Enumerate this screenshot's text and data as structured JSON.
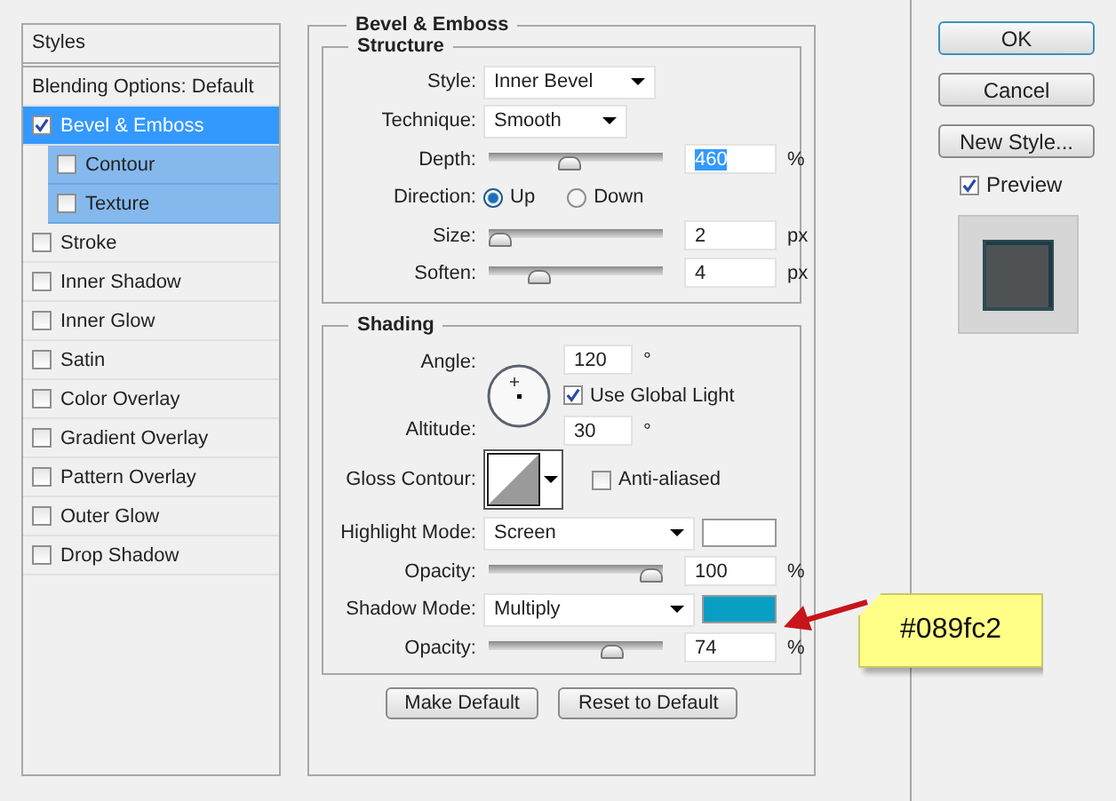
{
  "styles_panel": {
    "header": "Styles",
    "items": [
      {
        "label": "Blending Options: Default",
        "kind": "plain",
        "selected": false
      },
      {
        "label": "Bevel & Emboss",
        "kind": "checkbox",
        "checked": true,
        "selected": true,
        "children": [
          {
            "label": "Contour",
            "kind": "checkbox",
            "checked": false
          },
          {
            "label": "Texture",
            "kind": "checkbox",
            "checked": false
          }
        ]
      },
      {
        "label": "Stroke",
        "kind": "checkbox",
        "checked": false,
        "selected": false
      },
      {
        "label": "Inner Shadow",
        "kind": "checkbox",
        "checked": false,
        "selected": false
      },
      {
        "label": "Inner Glow",
        "kind": "checkbox",
        "checked": false,
        "selected": false
      },
      {
        "label": "Satin",
        "kind": "checkbox",
        "checked": false,
        "selected": false
      },
      {
        "label": "Color Overlay",
        "kind": "checkbox",
        "checked": false,
        "selected": false
      },
      {
        "label": "Gradient Overlay",
        "kind": "checkbox",
        "checked": false,
        "selected": false
      },
      {
        "label": "Pattern Overlay",
        "kind": "checkbox",
        "checked": false,
        "selected": false
      },
      {
        "label": "Outer Glow",
        "kind": "checkbox",
        "checked": false,
        "selected": false
      },
      {
        "label": "Drop Shadow",
        "kind": "checkbox",
        "checked": false,
        "selected": false
      }
    ]
  },
  "bevel_emboss": {
    "title": "Bevel & Emboss",
    "structure": {
      "title": "Structure",
      "style": {
        "label": "Style:",
        "value": "Inner Bevel"
      },
      "technique": {
        "label": "Technique:",
        "value": "Smooth"
      },
      "depth": {
        "label": "Depth:",
        "level": 0.46,
        "value": "460",
        "unit": "%",
        "text_selected": true
      },
      "direction": {
        "label": "Direction:",
        "options": [
          {
            "label": "Up",
            "selected": true
          },
          {
            "label": "Down",
            "selected": false
          }
        ]
      },
      "size": {
        "label": "Size:",
        "level": 0,
        "value": "2",
        "unit": "px",
        "text_selected": false
      },
      "soften": {
        "label": "Soften:",
        "level": 0.26,
        "value": "4",
        "unit": "px",
        "text_selected": false
      }
    },
    "shading": {
      "title": "Shading",
      "angle": {
        "label": "Angle:",
        "value": "120",
        "unit": "°"
      },
      "use_global_light": {
        "label": "Use Global Light",
        "checked": true
      },
      "altitude": {
        "label": "Altitude:",
        "value": "30",
        "unit": "°"
      },
      "gloss_contour": {
        "label": "Gloss Contour:"
      },
      "anti_aliased": {
        "label": "Anti-aliased",
        "checked": false
      },
      "highlight_mode": {
        "label": "Highlight Mode:",
        "value": "Screen",
        "color": "#ffffff"
      },
      "highlight_opacity": {
        "label": "Opacity:",
        "level": 1,
        "value": "100",
        "unit": "%",
        "text_selected": false
      },
      "shadow_mode": {
        "label": "Shadow Mode:",
        "value": "Multiply",
        "color": "#089fc2"
      },
      "shadow_opacity": {
        "label": "Opacity:",
        "level": 0.74,
        "value": "74",
        "unit": "%",
        "text_selected": false
      }
    },
    "buttons": [
      "Make Default",
      "Reset to Default"
    ]
  },
  "actions": {
    "buttons": [
      "OK",
      "Cancel",
      "New Style..."
    ],
    "preview": {
      "label": "Preview",
      "checked": true
    }
  },
  "annotation": {
    "text": "#089fc2"
  }
}
